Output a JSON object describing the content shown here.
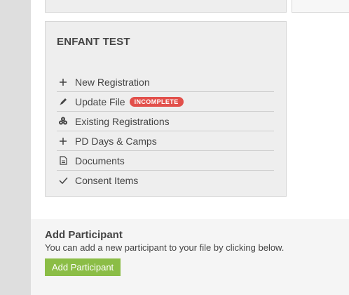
{
  "card": {
    "title": "ENFANT TEST",
    "items": [
      {
        "icon": "plus-icon",
        "label": "New Registration"
      },
      {
        "icon": "pencil-icon",
        "label": "Update File",
        "badge": "INCOMPLETE"
      },
      {
        "icon": "users-icon",
        "label": "Existing Registrations"
      },
      {
        "icon": "plus-icon",
        "label": "PD Days & Camps"
      },
      {
        "icon": "document-icon",
        "label": "Documents"
      },
      {
        "icon": "check-icon",
        "label": "Consent Items"
      }
    ]
  },
  "add_participant": {
    "heading": "Add Participant",
    "description": "You can add a new participant to your file by clicking below.",
    "button_label": "Add Participant"
  },
  "colors": {
    "badge": "#e2504b",
    "button": "#8bbd46"
  }
}
